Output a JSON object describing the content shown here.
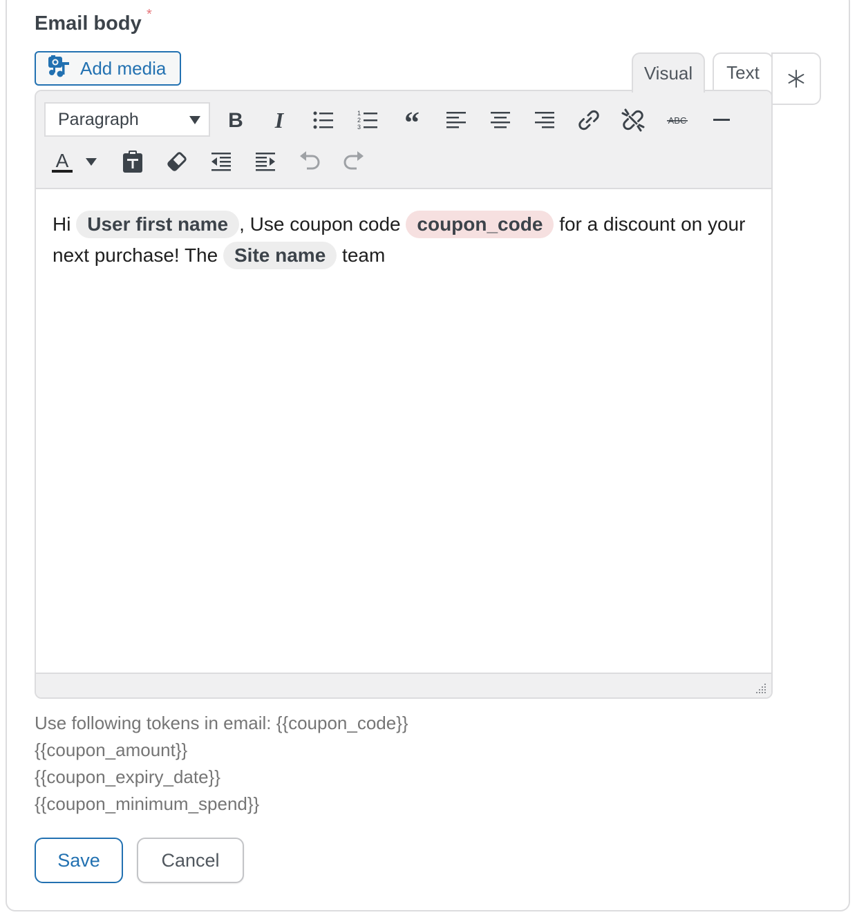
{
  "field": {
    "label": "Email body",
    "required_mark": "*"
  },
  "add_media": {
    "label": "Add media"
  },
  "editor_tabs": {
    "visual": "Visual",
    "text": "Text",
    "active": "Visual"
  },
  "toolbar": {
    "format_select": "Paragraph",
    "row1_icons": [
      "bold-icon",
      "italic-icon",
      "bullet-list-icon",
      "numbered-list-icon",
      "blockquote-icon",
      "align-left-icon",
      "align-center-icon",
      "align-right-icon",
      "insert-link-icon",
      "remove-link-icon",
      "strikethrough-icon",
      "horizontal-line-icon"
    ],
    "row2_icons": [
      "text-color-icon",
      "text-color-dropdown-icon",
      "paste-as-text-icon",
      "clear-formatting-icon",
      "outdent-icon",
      "indent-icon",
      "undo-icon",
      "redo-icon"
    ],
    "strikethrough_label": "ABC",
    "text_color_glyph": "A"
  },
  "content": {
    "p1": "Hi",
    "token_user": "User first name",
    "p2": ", Use coupon code",
    "token_coupon": "coupon_code",
    "p3": "for a discount on your next purchase! The",
    "token_site": "Site name",
    "p4": "team"
  },
  "help": {
    "line1": "Use following tokens in email: {{coupon_code}}",
    "line2": "{{coupon_amount}}",
    "line3": "{{coupon_expiry_date}}",
    "line4": "{{coupon_minimum_spend}}"
  },
  "actions": {
    "save": "Save",
    "cancel": "Cancel"
  },
  "colors": {
    "accent": "#2271b1",
    "required": "#e5757a",
    "token_bg": "#ededed",
    "token_coupon_bg": "#f6e0e0"
  }
}
